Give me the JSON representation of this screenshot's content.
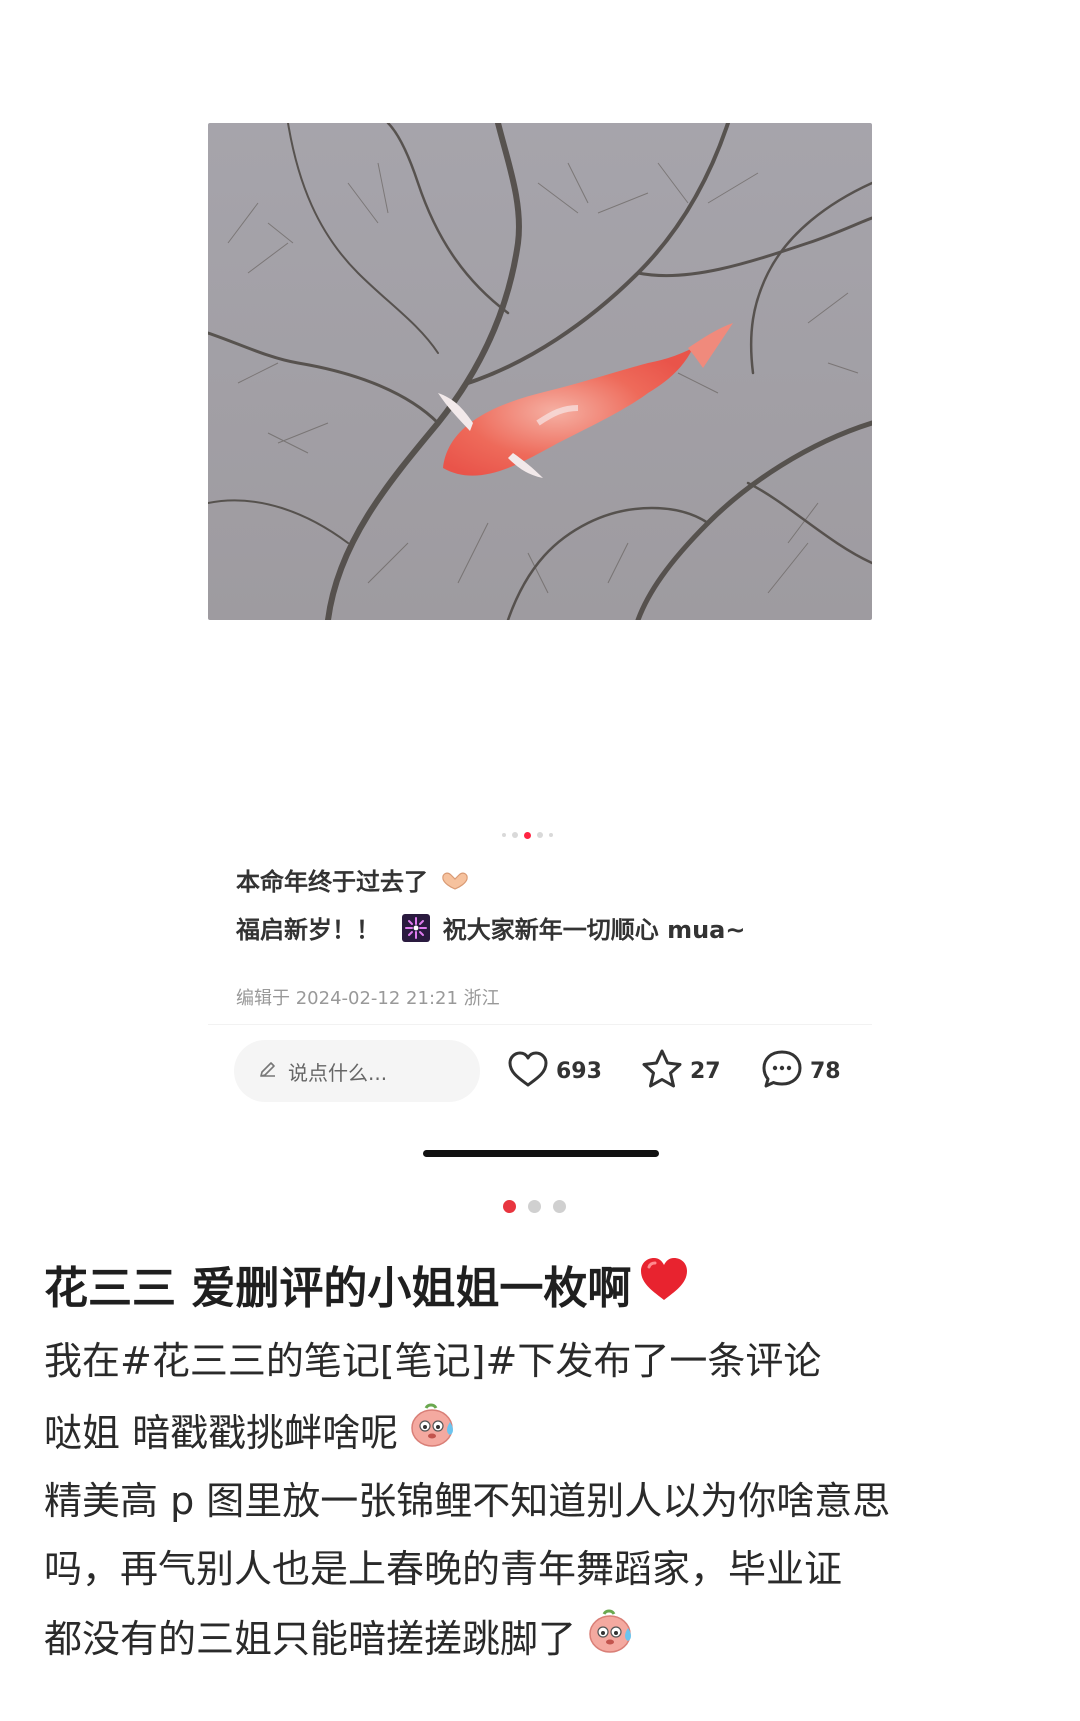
{
  "photo": {
    "icon": "koi-fish-in-pond-photo"
  },
  "carousel_top": {
    "count": 5,
    "active_index": 2
  },
  "post": {
    "line1": "本命年终于过去了",
    "line1_emoji": "heart-hands-icon",
    "line2_a": "福启新岁！！",
    "line2_emoji": "fireworks-icon",
    "line2_b": "祝大家新年一切顺心 mua~",
    "meta": "编辑于 2024-02-12 21:21 浙江"
  },
  "actions": {
    "comment_placeholder": "说点什么...",
    "likes": "693",
    "favorites": "27",
    "comments": "78"
  },
  "carousel_bottom": {
    "count": 3,
    "active_index": 0
  },
  "weibo": {
    "title": "花三三 爱删评的小姐姐一枚啊",
    "title_emoji": "red-heart-icon",
    "line1": "我在#花三三的笔记[笔记]#下发布了一条评论",
    "line2": "哒姐 暗戳戳挑衅啥呢",
    "line3": "精美高 p 图里放一张锦鲤不知道别人以为你啥意思",
    "line4": "吗，再气别人也是上春晚的青年舞蹈家，毕业证",
    "line5": "都没有的三姐只能暗搓搓跳脚了",
    "face_emoji": "sweating-face-icon"
  },
  "colors": {
    "accent": "#ff2442",
    "heart": "#e8353f"
  }
}
